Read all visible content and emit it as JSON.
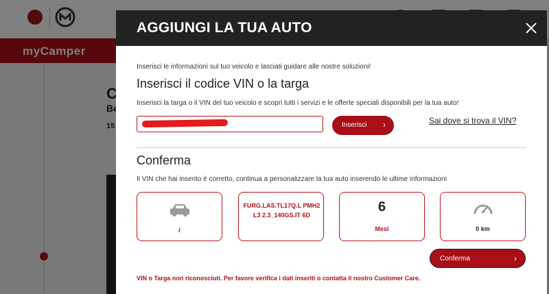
{
  "background": {
    "nav_title": "myCamper",
    "heading_partial": "C",
    "subheading_partial": "Be",
    "number_partial": "15"
  },
  "modal": {
    "title": "AGGIUNGI LA TUA AUTO",
    "intro": "Inserisci le informazioni sul tuo veicolo e lasciati guidare alle nostre soluzioni!",
    "vin_section": {
      "title": "Inserisci il codice VIN o la targa",
      "hint": "Inserisci la targa o il VIN del tuo veicolo e scopri tutti i servizi e le offerte speciali disponibili per la tua auto!",
      "input_value": "",
      "search_button": "Inserisci",
      "help_link": "Sai dove si trova il VIN?"
    },
    "confirm_section": {
      "title": "Conferma",
      "hint": "Il VIN che hai inserito è corretto, continua a personalizzare la tua auto inserendo le ultime informazioni",
      "cards": {
        "vehicle_label": "/",
        "model": "FURG.LAS.TL17Q.L PMH2 L3 2.3_140GS.IT 6D",
        "months_value": "6",
        "months_label": "Mesi",
        "km_label": "0 km"
      },
      "confirm_button": "Conferma"
    },
    "error": "VIN o Targa non riconosciuti. Per favore verifica i dati inseriti o contatta il nostro Customer Care."
  },
  "icons": {
    "car": "car-icon",
    "odometer": "odometer-icon",
    "close": "close-icon",
    "chevron": "chevron-right-icon"
  },
  "colors": {
    "brand_red": "#b0101b",
    "header_dark": "#222222"
  }
}
